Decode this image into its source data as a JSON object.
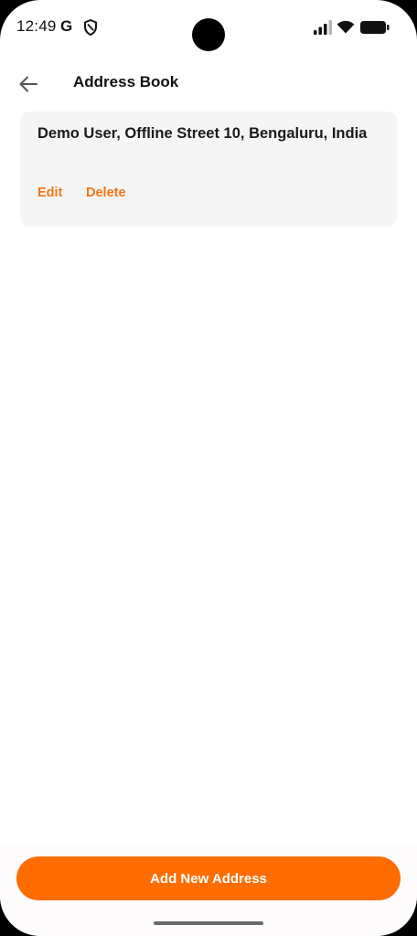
{
  "status_bar": {
    "time": "12:49",
    "g_glyph": "G",
    "icons": [
      "google-icon",
      "shield-icon",
      "signal-icon",
      "wifi-icon",
      "battery-icon"
    ]
  },
  "app_bar": {
    "back_icon": "arrow-left-icon",
    "title": "Address Book"
  },
  "addresses": [
    {
      "text": "Demo User, Offline Street 10, Bengaluru, India",
      "edit_label": "Edit",
      "delete_label": "Delete"
    }
  ],
  "footer": {
    "add_button_label": "Add New Address"
  },
  "colors": {
    "accent": "#ff6d00",
    "link": "#f47514",
    "card_bg": "#f5f5f5",
    "text": "#111111"
  }
}
